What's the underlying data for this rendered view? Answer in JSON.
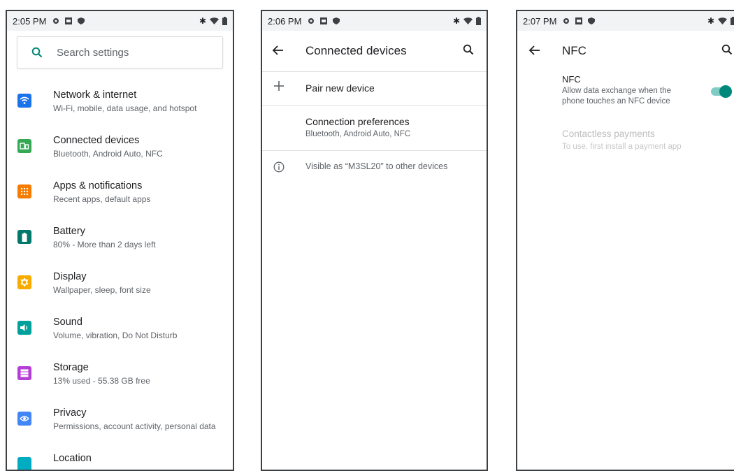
{
  "phones": [
    {
      "status": {
        "time": "2:05 PM"
      },
      "search": {
        "placeholder": "Search settings",
        "icon": "search-icon"
      },
      "items": [
        {
          "title": "Network & internet",
          "subtitle": "Wi-Fi, mobile, data usage, and hotspot",
          "icon": "wifi-icon",
          "color": "#1a73e8"
        },
        {
          "title": "Connected devices",
          "subtitle": "Bluetooth, Android Auto, NFC",
          "icon": "devices-icon",
          "color": "#34a853"
        },
        {
          "title": "Apps & notifications",
          "subtitle": "Recent apps, default apps",
          "icon": "apps-icon",
          "color": "#f57c00"
        },
        {
          "title": "Battery",
          "subtitle": "80% - More than 2 days left",
          "icon": "battery-icon",
          "color": "#00796b"
        },
        {
          "title": "Display",
          "subtitle": "Wallpaper, sleep, font size",
          "icon": "brightness-icon",
          "color": "#f9ab00"
        },
        {
          "title": "Sound",
          "subtitle": "Volume, vibration, Do Not Disturb",
          "icon": "volume-icon",
          "color": "#00a19a"
        },
        {
          "title": "Storage",
          "subtitle": "13% used - 55.38 GB free",
          "icon": "storage-icon",
          "color": "#b43fd6"
        },
        {
          "title": "Privacy",
          "subtitle": "Permissions, account activity, personal data",
          "icon": "privacy-icon",
          "color": "#4285f4"
        },
        {
          "title": "Location",
          "subtitle": "",
          "icon": "location-icon",
          "color": "#00acc1"
        }
      ]
    },
    {
      "status": {
        "time": "2:06 PM"
      },
      "title": "Connected devices",
      "rows": [
        {
          "title": "Pair new device",
          "icon": "plus-icon"
        },
        {
          "title": "Connection preferences",
          "subtitle": "Bluetooth, Android Auto, NFC"
        },
        {
          "title": "Visible as “M3SL20” to other devices",
          "icon": "info-icon"
        }
      ]
    },
    {
      "status": {
        "time": "2:07 PM"
      },
      "title": "NFC",
      "nfc": {
        "title": "NFC",
        "subtitle_line1": "Allow data exchange when the",
        "subtitle_line2": "phone touches an NFC device",
        "enabled": true
      },
      "payments": {
        "title": "Contactless payments",
        "subtitle": "To use, first install a payment app"
      }
    }
  ],
  "colors": {
    "accent": "#00897b"
  }
}
